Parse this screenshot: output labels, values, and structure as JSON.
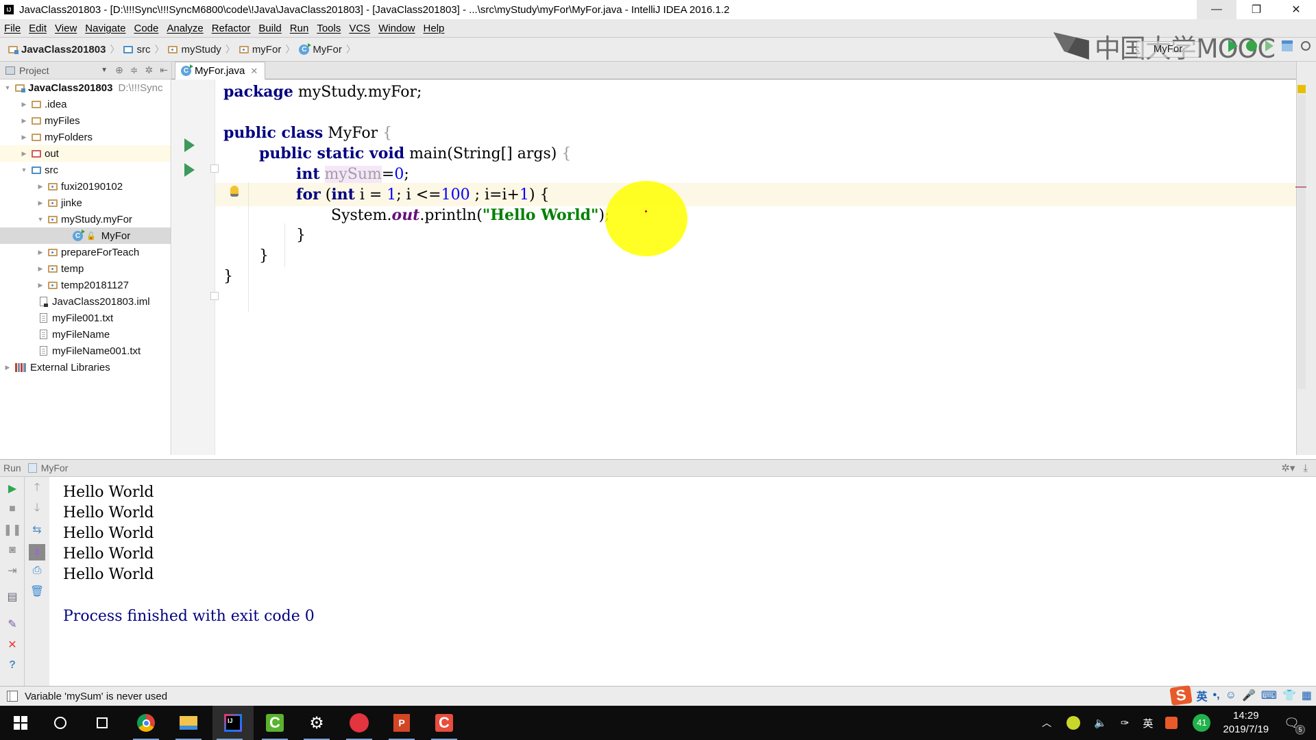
{
  "window": {
    "title": "JavaClass201803 - [D:\\!!!Sync\\!!!SyncM6800\\code\\!Java\\JavaClass201803] - [JavaClass201803] - ...\\src\\myStudy\\myFor\\MyFor.java - IntelliJ IDEA 2016.1.2",
    "app_icon": "IJ",
    "minimize": "—",
    "restore": "❐",
    "close": "✕"
  },
  "menu": [
    "File",
    "Edit",
    "View",
    "Navigate",
    "Code",
    "Analyze",
    "Refactor",
    "Build",
    "Run",
    "Tools",
    "VCS",
    "Window",
    "Help"
  ],
  "breadcrumb": [
    "JavaClass201803",
    "src",
    "myStudy",
    "myFor",
    "MyFor"
  ],
  "toolbar": {
    "run_config": "MyFor",
    "watermark": "中国大学MOOC"
  },
  "project_panel": {
    "title": "Project",
    "tree": [
      {
        "label": "JavaClass201803",
        "extra": "D:\\!!!Sync",
        "icon": "project-folder",
        "expanded": true,
        "level": 0
      },
      {
        "label": ".idea",
        "icon": "folder",
        "expanded": false,
        "level": 1
      },
      {
        "label": "myFiles",
        "icon": "folder",
        "expanded": false,
        "level": 1
      },
      {
        "label": "myFolders",
        "icon": "folder",
        "expanded": false,
        "level": 1
      },
      {
        "label": "out",
        "icon": "excluded-folder",
        "expanded": false,
        "level": 1
      },
      {
        "label": "src",
        "icon": "source-folder",
        "expanded": true,
        "level": 1
      },
      {
        "label": "fuxi20190102",
        "icon": "package",
        "expanded": false,
        "level": 2
      },
      {
        "label": "jinke",
        "icon": "package",
        "expanded": false,
        "level": 2
      },
      {
        "label": "myStudy.myFor",
        "icon": "package",
        "expanded": true,
        "level": 2
      },
      {
        "label": "MyFor",
        "icon": "class",
        "level": 3,
        "selected": true
      },
      {
        "label": "prepareForTeach",
        "icon": "package",
        "expanded": false,
        "level": 2
      },
      {
        "label": "temp",
        "icon": "package",
        "expanded": false,
        "level": 2
      },
      {
        "label": "temp20181127",
        "icon": "package",
        "expanded": false,
        "level": 2
      },
      {
        "label": "JavaClass201803.iml",
        "icon": "iml-file",
        "level": 1
      },
      {
        "label": "myFile001.txt",
        "icon": "text-file",
        "level": 1
      },
      {
        "label": "myFileName",
        "icon": "text-file",
        "level": 1
      },
      {
        "label": "myFileName001.txt",
        "icon": "text-file",
        "level": 1
      },
      {
        "label": "External Libraries",
        "icon": "library",
        "expanded": false,
        "level": 0
      }
    ]
  },
  "editor": {
    "tab": "MyFor.java",
    "lines": {
      "l1_kw": "package",
      "l1_rest": " myStudy.myFor;",
      "l3_kw": "public class",
      "l3_name": " MyFor ",
      "l3_brace": "{",
      "l4_kw": "public static void",
      "l4_rest": " main(String[] args) ",
      "l4_brace": "{",
      "l5_kw": "int",
      "l5_var": "mySum",
      "l5_eq": "=",
      "l5_num": "0",
      "l5_end": ";",
      "l6_kw": "for",
      "l6_a": " (",
      "l6_kw2": "int",
      "l6_b": " i = ",
      "l6_n1": "1",
      "l6_c": "; i <=",
      "l6_n2": "100",
      "l6_d": " ; i=i+",
      "l6_n3": "1",
      "l6_e": ") {",
      "l7_a": "System.",
      "l7_field": "out",
      "l7_b": ".println(",
      "l7_str": "\"Hello World\"",
      "l7_c": ");",
      "l8": "}",
      "l9": "}",
      "l10": "}"
    }
  },
  "run_panel": {
    "label": "Run",
    "config": "MyFor",
    "output": [
      "Hello World",
      "Hello World",
      "Hello World",
      "Hello World",
      "Hello World"
    ],
    "exit_message": "Process finished with exit code 0"
  },
  "status": {
    "message": "Variable 'mySum' is never used"
  },
  "ime_bar": {
    "logo": "S",
    "lang": "英",
    "punct": "•,",
    "emoji": "☺",
    "mic": "🎤",
    "keyboard": "⌨",
    "shirt": "👕",
    "grid": "▦"
  },
  "taskbar": {
    "apps": [
      "start",
      "search",
      "task-view",
      "chrome",
      "file-explorer",
      "intellij-idea",
      "camtasia",
      "settings",
      "keyboard-app",
      "powerpoint",
      "camtasia-recorder"
    ],
    "tray_lang": "英",
    "badge_count": "41",
    "time": "14:29",
    "date": "2019/7/19",
    "notifications": "5"
  }
}
